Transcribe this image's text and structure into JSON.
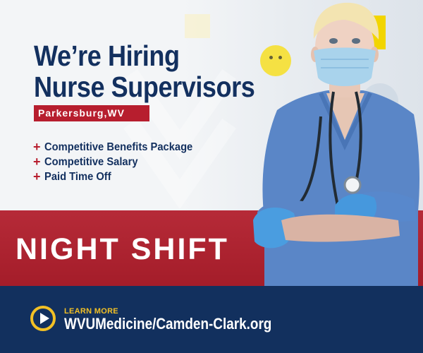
{
  "headline": {
    "line1": "We’re Hiring",
    "line2": "Nurse Supervisors"
  },
  "location": "Parkersburg,WV",
  "benefits": [
    {
      "symbol": "+",
      "text": "Competitive Benefits Package"
    },
    {
      "symbol": "+",
      "text": "Competitive Salary"
    },
    {
      "symbol": "+",
      "text": "Paid Time Off"
    }
  ],
  "shift_label": "NIGHT SHIFT",
  "cta": {
    "kicker": "LEARN MORE",
    "url_text": "WVUMedicine/Camden-Clark.org",
    "icon": "play-circle-icon"
  },
  "colors": {
    "navy": "#13305f",
    "red": "#b21f2d",
    "gold": "#f2c025",
    "scrubs": "#5b86c6"
  }
}
